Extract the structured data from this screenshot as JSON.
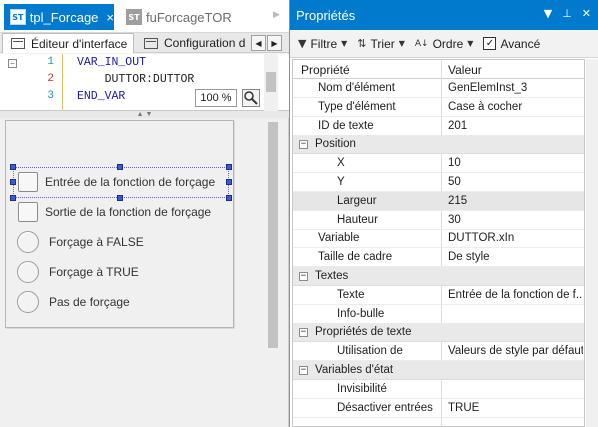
{
  "doc_tabs": [
    {
      "icon": "ST",
      "label": "tpl_Forcage",
      "close": "×"
    },
    {
      "icon": "ST",
      "label": "fuForcageTOR"
    }
  ],
  "sub_tabs": [
    {
      "label": "Éditeur d'interface"
    },
    {
      "label": "Configuration d"
    }
  ],
  "code": {
    "line_numbers": [
      "1",
      "2",
      "3"
    ],
    "lines": [
      "VAR_IN_OUT",
      "    DUTTOR:DUTTOR",
      "END_VAR"
    ],
    "zoom": "100 %"
  },
  "form_controls": {
    "checkboxes": [
      "Entrée de la fonction de forçage",
      "Sortie de la fonction de forçage"
    ],
    "radios": [
      "Forçage à FALSE",
      "Forçage à TRUE",
      "Pas de forçage"
    ]
  },
  "properties_panel": {
    "title": "Propriétés",
    "toolbar": {
      "filter": "Filtre",
      "sort": "Trier",
      "order": "Ordre",
      "advanced": "Avancé",
      "advanced_checked": true
    },
    "columns": {
      "name": "Propriété",
      "value": "Valeur"
    },
    "rows": [
      {
        "name": "Nom d'élément",
        "value": "GenElemInst_3",
        "level": 1,
        "cat": false
      },
      {
        "name": "Type d'élément",
        "value": "Case à cocher",
        "level": 1,
        "cat": false
      },
      {
        "name": "ID de texte",
        "value": "201",
        "level": 1,
        "cat": false
      },
      {
        "name": "Position",
        "value": "",
        "level": 0,
        "cat": true
      },
      {
        "name": "X",
        "value": "10",
        "level": 2,
        "cat": false
      },
      {
        "name": "Y",
        "value": "50",
        "level": 2,
        "cat": false
      },
      {
        "name": "Largeur",
        "value": "215",
        "level": 2,
        "cat": false,
        "highlight": true
      },
      {
        "name": "Hauteur",
        "value": "30",
        "level": 2,
        "cat": false
      },
      {
        "name": "Variable",
        "value": "DUTTOR.xIn",
        "level": 1,
        "cat": false
      },
      {
        "name": "Taille de cadre",
        "value": "De style",
        "level": 1,
        "cat": false
      },
      {
        "name": "Textes",
        "value": "",
        "level": 0,
        "cat": true
      },
      {
        "name": "Texte",
        "value": "Entrée de la fonction de f...",
        "level": 2,
        "cat": false
      },
      {
        "name": "Info-bulle",
        "value": "",
        "level": 2,
        "cat": false
      },
      {
        "name": "Propriétés de texte",
        "value": "",
        "level": 0,
        "cat": true
      },
      {
        "name": "Utilisation de",
        "value": "Valeurs de style par défaut",
        "level": 2,
        "cat": false
      },
      {
        "name": "Variables d'état",
        "value": "",
        "level": 0,
        "cat": true
      },
      {
        "name": "Invisibilité",
        "value": "",
        "level": 2,
        "cat": false
      },
      {
        "name": "Désactiver entrées",
        "value": "TRUE",
        "level": 2,
        "cat": false
      }
    ]
  },
  "colors": {
    "accent": "#007acc",
    "keyword": "#1a1aa6",
    "selection_handle": "#3b5bdb"
  }
}
